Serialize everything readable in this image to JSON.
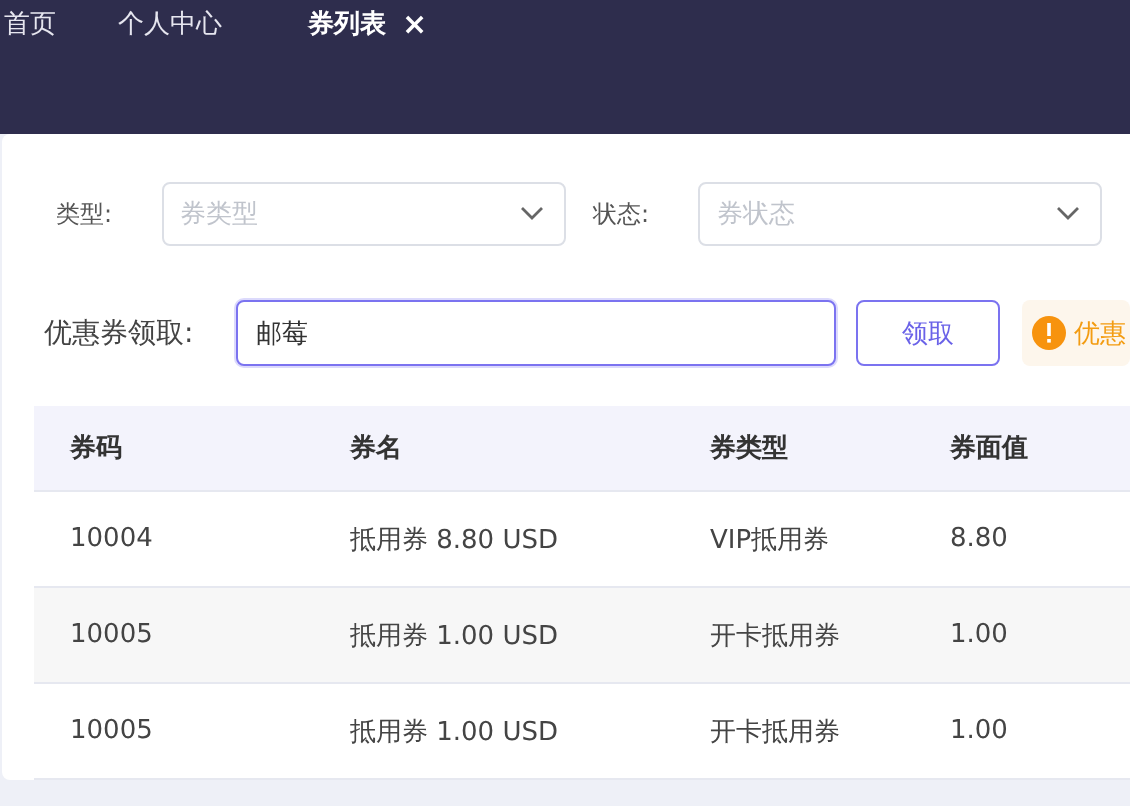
{
  "tabs": [
    {
      "label": "首页",
      "selected": false
    },
    {
      "label": "个人中心",
      "selected": false
    },
    {
      "label": "券列表",
      "selected": true,
      "close": "×"
    }
  ],
  "filters": [
    {
      "label": "类型:",
      "placeholder": "券类型"
    },
    {
      "label": "状态:",
      "placeholder": "券状态"
    }
  ],
  "claim": {
    "label": "优惠券领取:",
    "value": "邮莓",
    "button": "领取",
    "notice": "优惠"
  },
  "table": {
    "columns": [
      "券码",
      "券名",
      "券类型",
      "券面值"
    ],
    "rows": [
      [
        "10004",
        "抵用券 8.80 USD",
        "VIP抵用券",
        "8.80"
      ],
      [
        "10005",
        "抵用券 1.00 USD",
        "开卡抵用券",
        "1.00"
      ],
      [
        "10005",
        "抵用券 1.00 USD",
        "开卡抵用券",
        "1.00"
      ]
    ]
  }
}
